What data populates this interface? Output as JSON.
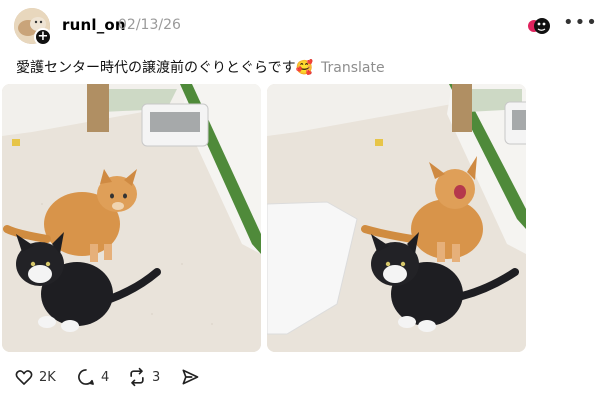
{
  "post": {
    "username": "runl_on",
    "date": "02/13/26",
    "text": "愛護センター時代の譲渡前のぐりとぐらです🥰",
    "translate_label": "Translate"
  },
  "actions": {
    "likes": "2K",
    "replies": "4",
    "reposts": "3"
  },
  "icons": {
    "avatar_add": "plus-icon",
    "more": "more-icon",
    "like": "heart-icon",
    "reply": "comment-icon",
    "repost": "repost-icon",
    "share": "share-icon"
  },
  "colors": {
    "floor": "#e9e3da",
    "wall": "#f7f6f3",
    "green_trim": "#4f8a3a",
    "kitten_orange": "#d8944a",
    "kitten_black": "#1e1e22",
    "muted_text": "#8e8e8e"
  }
}
